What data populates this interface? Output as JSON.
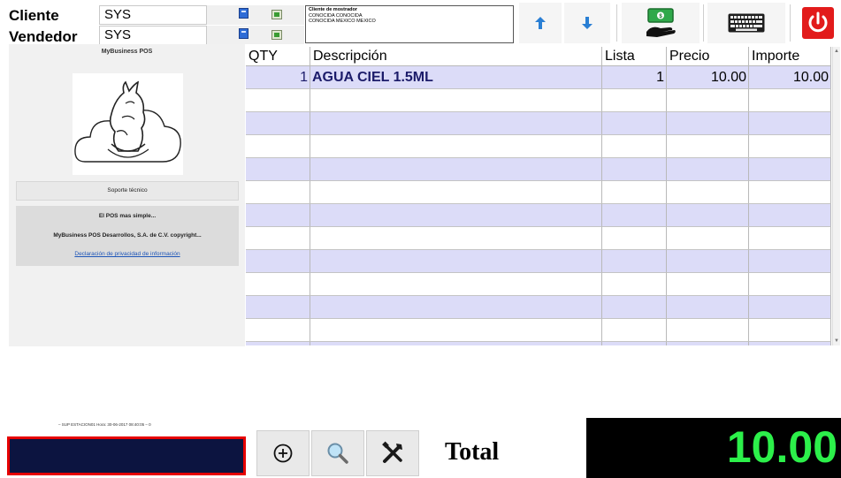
{
  "header": {
    "client_label": "Cliente",
    "client_value": "SYS",
    "seller_label": "Vendedor",
    "seller_value": "SYS",
    "client_info": {
      "line1": "Cliente de mostrador",
      "line2": "CONOCIDA CONOCIDA",
      "line3": "CONOCIDA MEXICO MEXICO"
    },
    "tool_icons": [
      "arrow-up-icon",
      "arrow-down-icon",
      "cash-payment-icon",
      "keyboard-icon",
      "power-icon"
    ]
  },
  "left_panel": {
    "title": "MyBusiness POS",
    "support": "Soporte técnico",
    "tagline": "El POS mas simple...",
    "copyright": "MyBusiness POS Desarrollos, S.A. de C.V. copyright...",
    "privacy_link": "Declaración de privacidad de información"
  },
  "grid": {
    "headers": {
      "qty": "QTY",
      "desc": "Descripción",
      "lista": "Lista",
      "precio": "Precio",
      "importe": "Importe"
    },
    "rows": [
      {
        "qty": "1",
        "desc": "AGUA CIEL 1.5ML",
        "lista": "1",
        "precio": "10.00",
        "importe": "10.00"
      }
    ],
    "empty_rows": 12
  },
  "footer": {
    "status_text": "– SUP ESTACION01 Hora: 30-06-2017 08:40:05 – 0",
    "total_label": "Total",
    "total_value": "10.00",
    "button_icons": [
      "add-circle-icon",
      "magnifier-icon",
      "tools-icon"
    ]
  },
  "colors": {
    "row_lavender": "#dcdcf8",
    "scan_bg": "#0c1440",
    "scan_border": "#e60000",
    "total_green": "#2cf04a",
    "power_red": "#e21b1b"
  }
}
